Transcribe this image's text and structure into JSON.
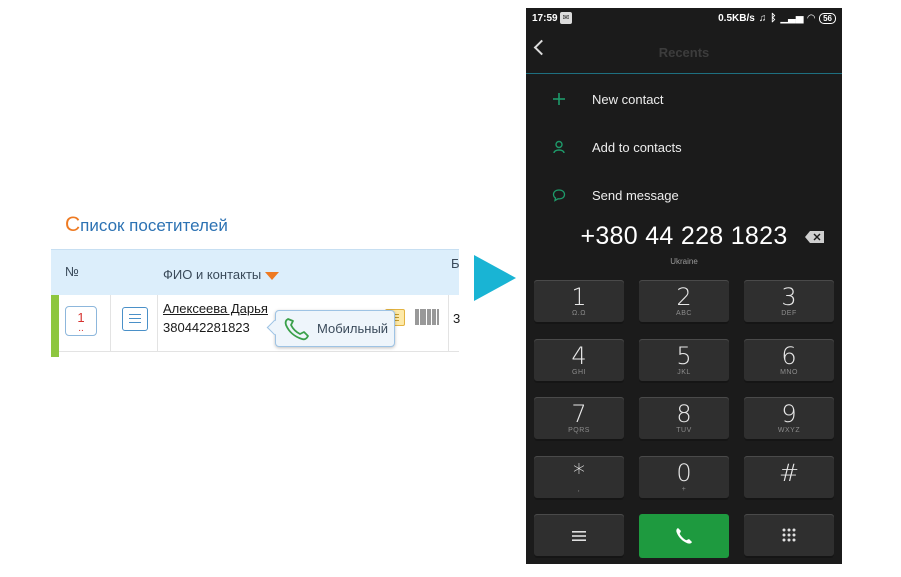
{
  "web": {
    "title_first": "С",
    "title_rest": "писок посетителей",
    "col_num": "№",
    "col_fio": "ФИО и контакты",
    "col_cut": "Б",
    "row": {
      "number": "1",
      "number_dots": "..",
      "name": "Алексеева Дарья",
      "phone": "380442281823",
      "cut": "3"
    },
    "tooltip_label": "Мобильный"
  },
  "phone": {
    "status": {
      "time": "17:59",
      "speed": "0.5KB/s",
      "battery": "56"
    },
    "title": "Recents",
    "actions": [
      {
        "label": "New contact",
        "icon": "plus-icon"
      },
      {
        "label": "Add to contacts",
        "icon": "person-icon"
      },
      {
        "label": "Send message",
        "icon": "message-icon"
      }
    ],
    "number": "+380 44 228 1823",
    "country": "Ukraine",
    "keys": [
      {
        "digit": "1",
        "letters": "Ω.Ω"
      },
      {
        "digit": "2",
        "letters": "ABC"
      },
      {
        "digit": "3",
        "letters": "DEF"
      },
      {
        "digit": "4",
        "letters": "GHI"
      },
      {
        "digit": "5",
        "letters": "JKL"
      },
      {
        "digit": "6",
        "letters": "MNO"
      },
      {
        "digit": "7",
        "letters": "PQRS"
      },
      {
        "digit": "8",
        "letters": "TUV"
      },
      {
        "digit": "9",
        "letters": "WXYZ"
      },
      {
        "digit": "*",
        "letters": ","
      },
      {
        "digit": "0",
        "letters": "+"
      },
      {
        "digit": "#",
        "letters": ""
      }
    ],
    "accent_color": "#1e9a3f"
  }
}
